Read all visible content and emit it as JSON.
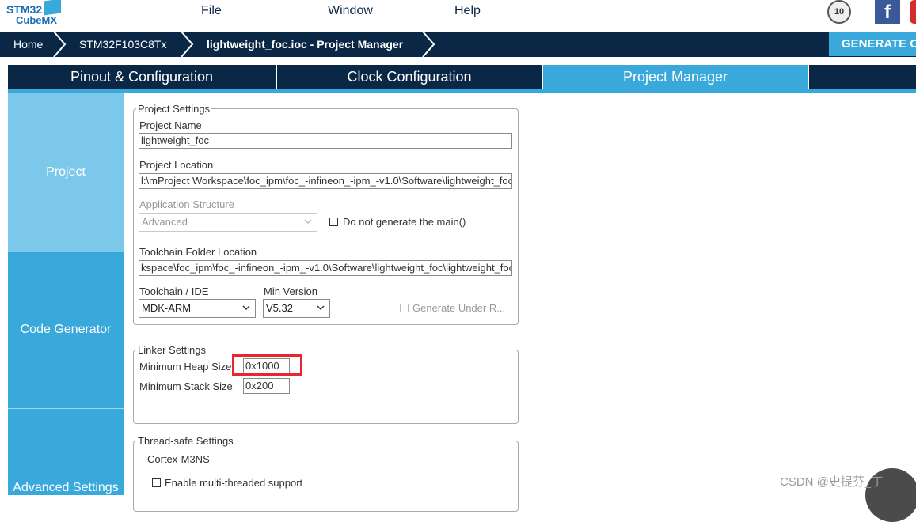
{
  "app": {
    "logo_line1": "STM32",
    "logo_line2": "CubeMX"
  },
  "menu": {
    "file": "File",
    "window": "Window",
    "help": "Help"
  },
  "badges": {
    "anniversary": "10",
    "facebook": "f"
  },
  "breadcrumb": {
    "home": "Home",
    "device": "STM32F103C8Tx",
    "current": "lightweight_foc.ioc - Project Manager"
  },
  "generate_label": "GENERATE C",
  "tabs": [
    {
      "label": "Pinout & Configuration"
    },
    {
      "label": "Clock Configuration"
    },
    {
      "label": "Project Manager"
    }
  ],
  "sidebar": [
    {
      "label": "Project"
    },
    {
      "label": "Code Generator"
    },
    {
      "label": "Advanced Settings"
    }
  ],
  "project_settings": {
    "legend": "Project Settings",
    "name_label": "Project Name",
    "name_value": "lightweight_foc",
    "location_label": "Project Location",
    "location_value": "l:\\mProject Workspace\\foc_ipm\\foc_-infineon_-ipm_-v1.0\\Software\\lightweight_foc",
    "app_structure_label": "Application Structure",
    "app_structure_value": "Advanced",
    "no_main_label": "Do not generate the main()",
    "toolchain_folder_label": "Toolchain Folder Location",
    "toolchain_folder_value": "kspace\\foc_ipm\\foc_-infineon_-ipm_-v1.0\\Software\\lightweight_foc\\lightweight_foc\\",
    "toolchain_label": "Toolchain / IDE",
    "toolchain_value": "MDK-ARM",
    "min_version_label": "Min Version",
    "min_version_value": "V5.32",
    "generate_under_label": "Generate Under R..."
  },
  "linker_settings": {
    "legend": "Linker Settings",
    "heap_label": "Minimum Heap Size",
    "heap_value": "0x1000",
    "stack_label": "Minimum Stack Size",
    "stack_value": "0x200"
  },
  "thread_safe": {
    "legend": "Thread-safe Settings",
    "core": "Cortex-M3NS",
    "multithread_label": "Enable multi-threaded support"
  },
  "watermark": "CSDN @史提芬_丁",
  "colors": {
    "navy": "#0b2746",
    "accent": "#39a9dc",
    "highlight": "#e8262f"
  }
}
